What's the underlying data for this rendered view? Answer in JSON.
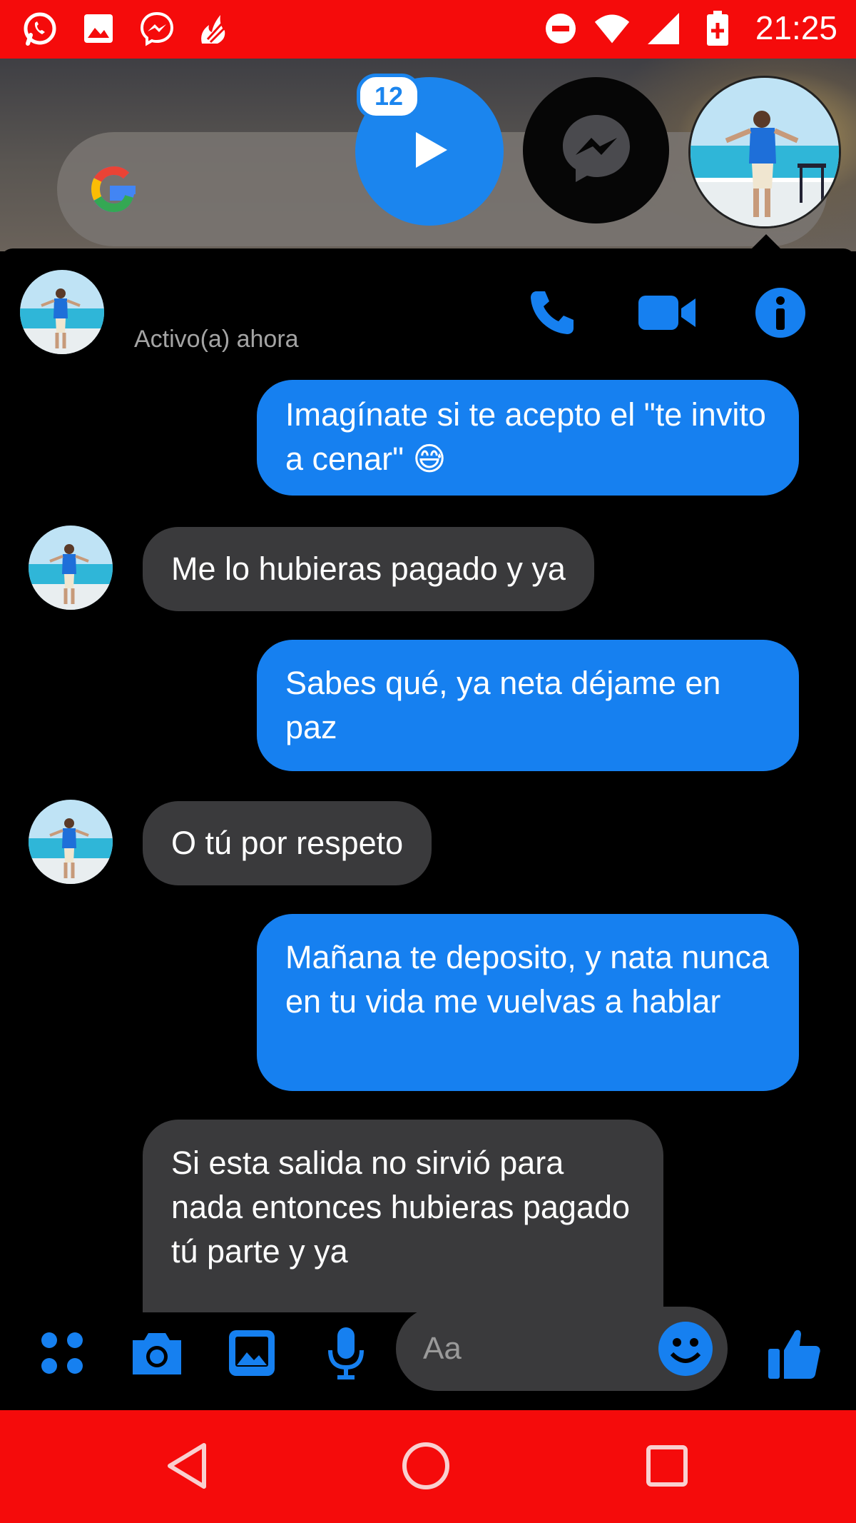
{
  "status_bar": {
    "time": "21:25",
    "left_icons": [
      "whatsapp-icon",
      "gallery-icon",
      "messenger-icon",
      "flame-icon"
    ],
    "right_icons": [
      "do-not-disturb-icon",
      "wifi-icon",
      "signal-icon",
      "battery-icon"
    ]
  },
  "chat_heads": {
    "unread_badge": "12",
    "heads": [
      "video-play-head",
      "messenger-head",
      "contact-avatar-head"
    ]
  },
  "conversation": {
    "contact_status": "Activo(a) ahora",
    "header_actions": [
      "phone-icon",
      "video-camera-icon",
      "info-icon"
    ],
    "messages": [
      {
        "direction": "out",
        "text": "Imagínate si te acepto el \"te invito a cenar\" 😅"
      },
      {
        "direction": "in",
        "text": "Me lo hubieras pagado y ya"
      },
      {
        "direction": "out",
        "text": "Sabes qué, ya neta déjame en paz"
      },
      {
        "direction": "in",
        "text": "O tú por respeto"
      },
      {
        "direction": "out",
        "text": "Mañana te deposito, y nata nunca en tu vida me vuelvas a hablar"
      },
      {
        "direction": "in",
        "text": "Si esta salida no sirvió para nada entonces hubieras pagado tú parte y ya"
      }
    ]
  },
  "composer": {
    "placeholder": "Aa",
    "actions": [
      "apps-icon",
      "camera-icon",
      "image-icon",
      "microphone-icon",
      "emoji-icon",
      "thumbs-up-icon"
    ]
  },
  "colors": {
    "status_bar": "#f50b0b",
    "accent": "#1680f0",
    "incoming_bubble": "#3a3a3c",
    "background": "#000000"
  }
}
